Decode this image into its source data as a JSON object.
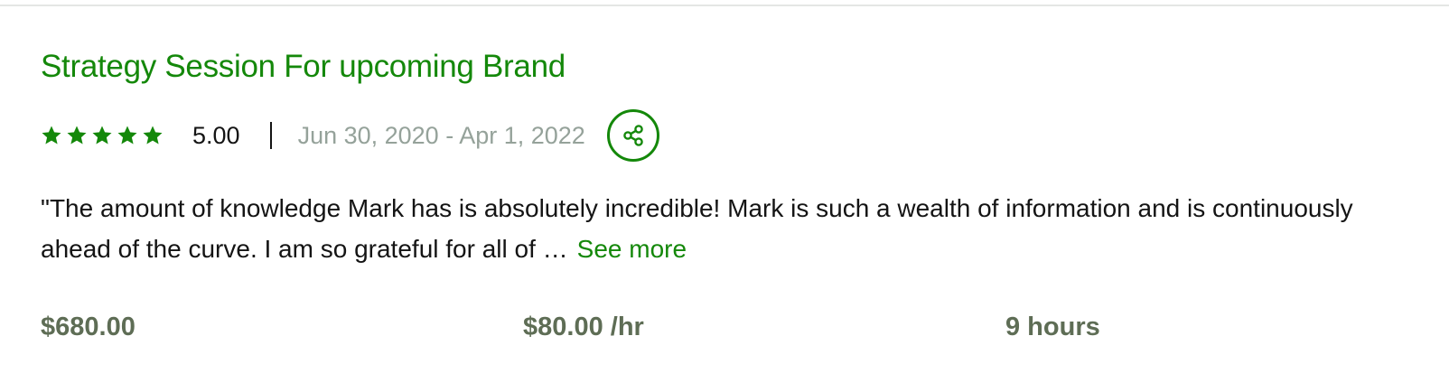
{
  "job": {
    "title": "Strategy Session For upcoming Brand",
    "rating": "5.00",
    "stars_filled": 5,
    "stars_total": 5,
    "date_range": "Jun 30, 2020 - Apr 1, 2022",
    "review_text": "\"The amount of knowledge Mark has is absolutely incredible! Mark is such a wealth of information and is continuously ahead of the curve. I am so grateful for all of …",
    "see_more_label": "See more",
    "total_earned": "$680.00",
    "hourly_rate": "$80.00 /hr",
    "hours": "9 hours"
  },
  "icons": {
    "star": "star-icon",
    "share": "share-icon"
  },
  "colors": {
    "accent": "#14880a",
    "muted_text": "#95a29a",
    "stat_text": "#5e6d55",
    "body_text": "#141414"
  }
}
